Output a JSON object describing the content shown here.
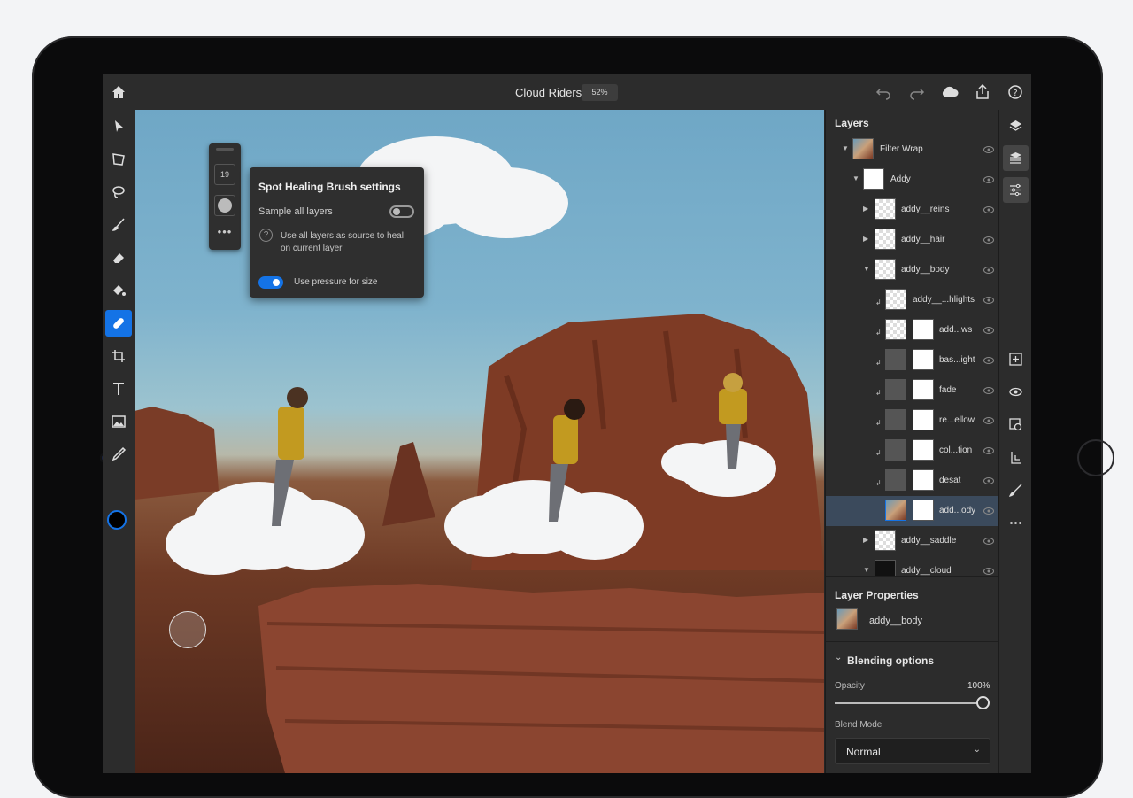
{
  "document": {
    "title": "Cloud Riders",
    "zoom": "52%"
  },
  "topbar": {
    "icons": [
      "home-icon",
      "undo-icon",
      "redo-icon",
      "cloud-icon",
      "share-icon",
      "help-icon"
    ]
  },
  "toolbar": {
    "tools": [
      "select-icon",
      "transform-icon",
      "lasso-icon",
      "brush-icon",
      "eraser-icon",
      "fill-icon",
      "spot-healing-icon",
      "crop-icon",
      "type-icon",
      "place-image-icon",
      "eyedropper-icon"
    ],
    "active_tool": "spot-healing-icon",
    "foreground_color": "#000000",
    "background_color": "#ffffff"
  },
  "brush_strip": {
    "size": "19",
    "more": "•••"
  },
  "heal_settings": {
    "title": "Spot Healing Brush settings",
    "sample_all_label": "Sample all layers",
    "sample_all_on": false,
    "sample_all_desc": "Use all layers as source to heal on current layer",
    "pressure_label": "Use pressure for size",
    "pressure_on": true
  },
  "layers": {
    "title": "Layers",
    "items": [
      {
        "name": "Filter Wrap",
        "expanded": true
      },
      {
        "name": "Addy",
        "expanded": true
      },
      {
        "name": "addy__reins",
        "expanded": false
      },
      {
        "name": "addy__hair",
        "expanded": false
      },
      {
        "name": "addy__body",
        "expanded": true
      },
      {
        "name": "addy__...hlights"
      },
      {
        "name": "add...ws"
      },
      {
        "name": "bas...ight"
      },
      {
        "name": "fade"
      },
      {
        "name": "re...ellow"
      },
      {
        "name": "col...tion"
      },
      {
        "name": "desat"
      },
      {
        "name": "add...ody",
        "selected": true
      },
      {
        "name": "addy__saddle",
        "expanded": false
      },
      {
        "name": "addy__cloud",
        "expanded": true
      }
    ]
  },
  "layer_properties": {
    "title": "Layer Properties",
    "layer_name": "addy__body",
    "blending_title": "Blending options",
    "opacity_label": "Opacity",
    "opacity_value": "100%",
    "blend_mode_label": "Blend Mode",
    "blend_mode_value": "Normal"
  },
  "right_bar": {
    "icons": [
      "layers-icon",
      "layer-properties-icon",
      "adjustments-icon",
      "add-layer-icon",
      "visibility-icon",
      "mask-icon",
      "clip-icon",
      "paint-icon",
      "more-icon"
    ]
  },
  "colors": {
    "accent": "#1473e6",
    "panel": "#2c2c2c",
    "selected_row": "#3b4a5c"
  }
}
